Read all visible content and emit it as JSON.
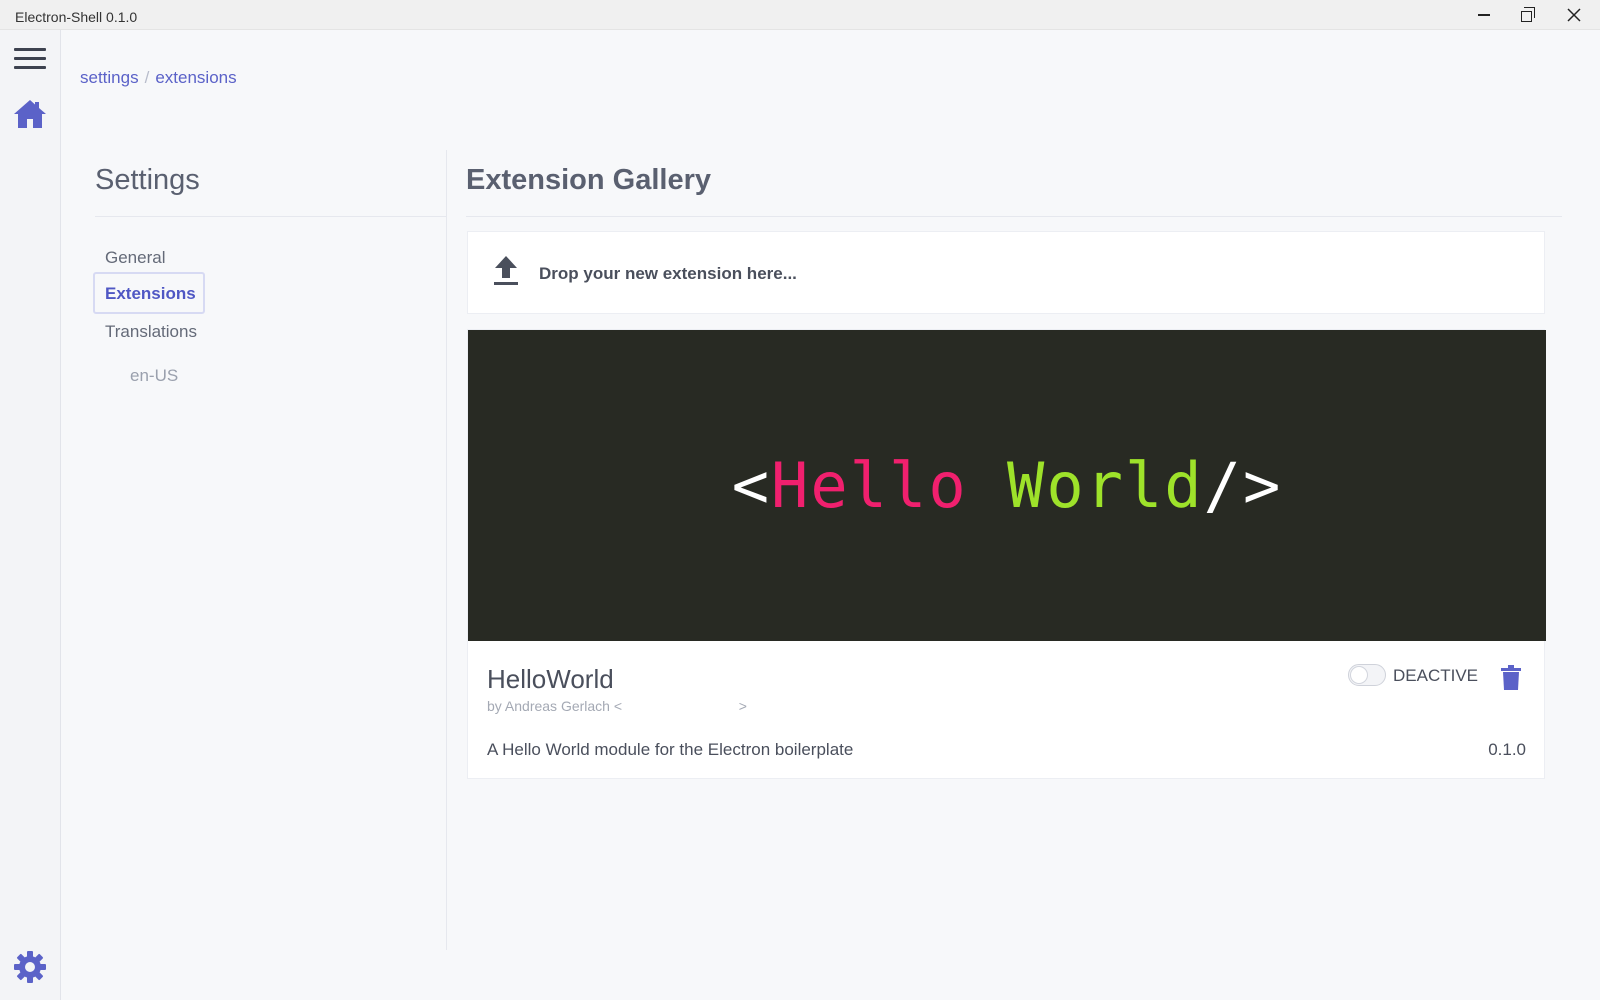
{
  "window": {
    "title": "Electron-Shell 0.1.0",
    "controls": {
      "minimize": "minimize",
      "maximize": "restore",
      "close": "close"
    }
  },
  "rail": {
    "menu_icon": "hamburger-menu-icon",
    "home_icon": "home-icon",
    "settings_icon": "gear-icon",
    "accent_color": "#5b62c8"
  },
  "breadcrumb": {
    "items": [
      "settings",
      "extensions"
    ],
    "separator": "/"
  },
  "settings": {
    "title": "Settings",
    "nav": [
      {
        "label": "General",
        "active": false
      },
      {
        "label": "Extensions",
        "active": true
      },
      {
        "label": "Translations",
        "active": false
      }
    ],
    "sub_items": [
      "en-US"
    ]
  },
  "gallery": {
    "title": "Extension Gallery",
    "dropzone": {
      "icon": "upload-icon",
      "text": "Drop your new extension here..."
    },
    "extensions": [
      {
        "banner": {
          "open": "<",
          "word1": "Hello",
          "word2": "World",
          "close": "/>",
          "bg_color": "#282a23",
          "word1_color": "#f0206e",
          "word2_color": "#9ee22a"
        },
        "name": "HelloWorld",
        "author": "by Andreas Gerlach <                              >",
        "description": "A Hello World module for the Electron boilerplate",
        "version": "0.1.0",
        "status_label": "DEACTIVE",
        "active": false,
        "delete_icon": "trash-icon"
      }
    ]
  }
}
